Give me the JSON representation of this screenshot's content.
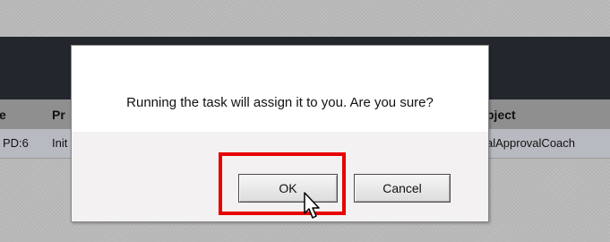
{
  "background_page": {
    "header_columns": {
      "col1": "e",
      "col2": "Pr",
      "col3": "bject"
    },
    "row": {
      "col1": "PD:6",
      "col2": "Init",
      "col3": "alApprovalCoach"
    }
  },
  "dialog": {
    "message": "Running the task will assign it to you. Are you sure?",
    "ok_label": "OK",
    "cancel_label": "Cancel"
  },
  "colors": {
    "highlight": "#e60000",
    "banner": "#23272d"
  }
}
